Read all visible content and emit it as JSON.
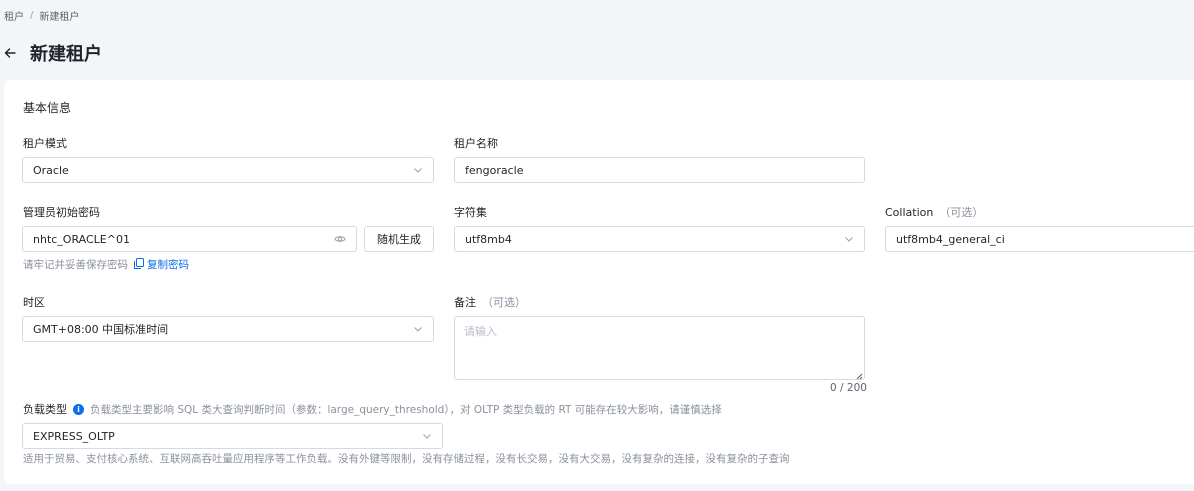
{
  "breadcrumb": {
    "parent": "租户",
    "separator": "/",
    "current": "新建租户"
  },
  "header": {
    "title": "新建租户"
  },
  "section": {
    "title": "基本信息"
  },
  "form": {
    "tenant_mode": {
      "label": "租户模式",
      "value": "Oracle"
    },
    "tenant_name": {
      "label": "租户名称",
      "value": "fengoracle"
    },
    "admin_password": {
      "label": "管理员初始密码",
      "value": "nhtc_ORACLE^01",
      "generate_label": "随机生成",
      "hint": "请牢记并妥善保存密码",
      "copy_label": "复制密码"
    },
    "charset": {
      "label": "字符集",
      "value": "utf8mb4"
    },
    "collation": {
      "label": "Collation",
      "optional": "（可选）",
      "value": "utf8mb4_general_ci"
    },
    "timezone": {
      "label": "时区",
      "value": "GMT+08:00 中国标准时间"
    },
    "remark": {
      "label": "备注",
      "optional": "（可选）",
      "placeholder": "请输入",
      "counter": "0 / 200"
    },
    "workload": {
      "label": "负载类型",
      "info": "负载类型主要影响 SQL 类大查询判断时间（参数：large_query_threshold），对 OLTP 类型负载的 RT 可能存在较大影响，请谨慎选择",
      "value": "EXPRESS_OLTP",
      "description": "适用于贸易、支付核心系统、互联网高吞吐量应用程序等工作负载。没有外键等限制，没有存储过程，没有长交易，没有大交易，没有复杂的连接，没有复杂的子查询"
    }
  },
  "colors": {
    "accent": "#0b6ee9",
    "border": "#d6dae0",
    "muted": "#8a919c",
    "background": "#f3f5f8"
  },
  "icons": [
    "back-arrow-icon",
    "chevron-down-icon",
    "eye-icon",
    "copy-icon",
    "info-icon"
  ]
}
